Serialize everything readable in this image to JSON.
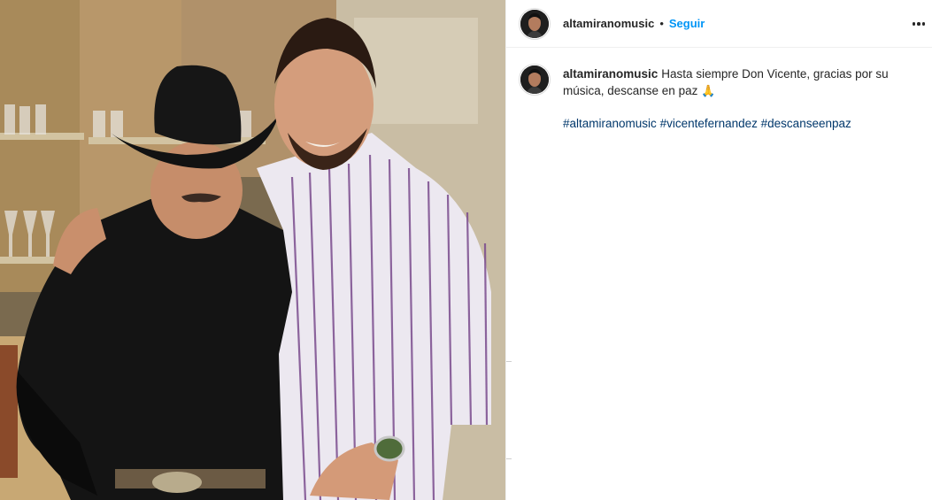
{
  "post": {
    "author": "altamiranomusic",
    "separator": "•",
    "follow_label": "Seguir",
    "more_icon": "more-horizontal-icon"
  },
  "caption": {
    "author": "altamiranomusic",
    "text": "Hasta siempre Don Vicente, gracias por su música, descanse en paz",
    "emoji": "🙏",
    "hashtags": [
      "#altamiranomusic",
      "#vicentefernandez",
      "#descanseenpaz"
    ]
  },
  "colors": {
    "link_blue": "#0095f6",
    "hashtag_blue": "#00376b",
    "text": "#262626",
    "border": "#efefef"
  }
}
